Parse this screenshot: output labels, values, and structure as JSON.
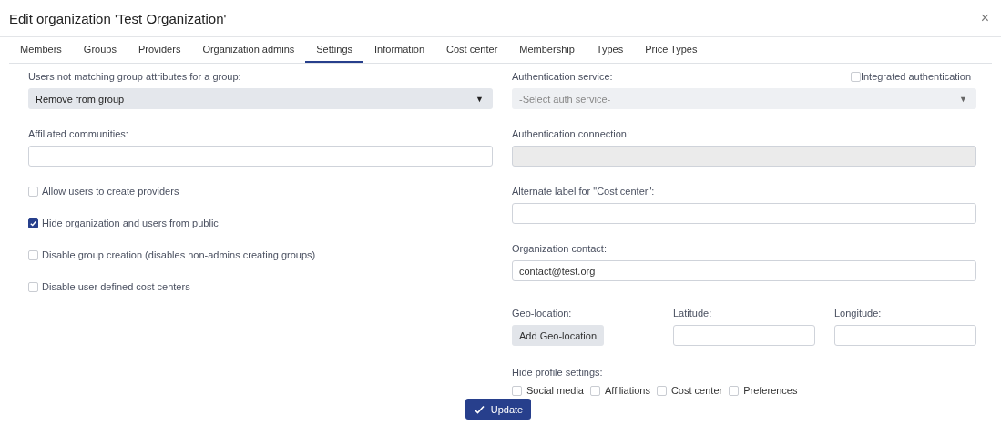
{
  "window": {
    "title": "Edit organization 'Test Organization'",
    "close": "×"
  },
  "tabs": [
    {
      "label": "Members",
      "selected": false
    },
    {
      "label": "Groups",
      "selected": false
    },
    {
      "label": "Providers",
      "selected": false
    },
    {
      "label": "Organization admins",
      "selected": false
    },
    {
      "label": "Settings",
      "selected": true
    },
    {
      "label": "Information",
      "selected": false
    },
    {
      "label": "Cost center",
      "selected": false
    },
    {
      "label": "Membership",
      "selected": false
    },
    {
      "label": "Types",
      "selected": false
    },
    {
      "label": "Price Types",
      "selected": false
    }
  ],
  "left": {
    "group_policy": {
      "label": "Users not matching group attributes for a group:",
      "value": "Remove from group",
      "caret": "▼"
    },
    "affiliated_communities": {
      "label": "Affiliated communities:"
    },
    "checkboxes": [
      {
        "label": "Allow users to create providers",
        "checked": false
      },
      {
        "label": "Hide organization and users from public",
        "checked": true
      },
      {
        "label": "Disable group creation (disables non-admins creating groups)",
        "checked": false
      },
      {
        "label": "Disable user defined cost centers",
        "checked": false
      }
    ]
  },
  "right": {
    "auth_service": {
      "label": "Authentication service:",
      "placeholder": "-Select auth service-",
      "caret": "▼",
      "disabled": true
    },
    "integrated_auth": {
      "label": "Integrated authentication",
      "checked": false
    },
    "auth_connection": {
      "label": "Authentication connection:",
      "disabled": true
    },
    "cost_center_label": {
      "label": "Alternate label for \"Cost center\":"
    },
    "contact": {
      "label": "Organization contact:",
      "value": "contact@test.org"
    },
    "geo": {
      "label": "Geo-location:",
      "button": "Add Geo-location"
    },
    "latitude": {
      "label": "Latitude:"
    },
    "longitude": {
      "label": "Longitude:"
    },
    "hide_profile": {
      "label": "Hide profile settings:",
      "options": [
        {
          "label": "Social media",
          "checked": false
        },
        {
          "label": "Affiliations",
          "checked": false
        },
        {
          "label": "Cost center",
          "checked": false
        },
        {
          "label": "Preferences",
          "checked": false
        }
      ]
    }
  },
  "update_button": "Update"
}
